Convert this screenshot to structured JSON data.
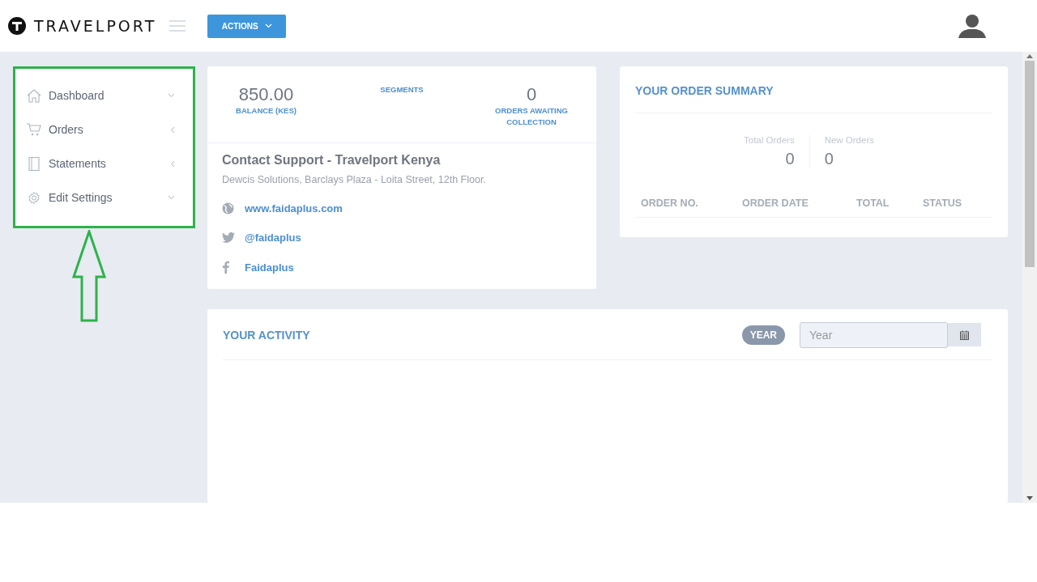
{
  "header": {
    "brand": "TRAVELPORT",
    "actions_button": {
      "label": "ACTIONS"
    }
  },
  "sidebar": {
    "highlighted": true,
    "items": [
      {
        "label": "Dashboard",
        "kind": "home",
        "expanded": true
      },
      {
        "label": "Orders",
        "kind": "cart",
        "expanded": false
      },
      {
        "label": "Statements",
        "kind": "book",
        "expanded": false
      },
      {
        "label": "Edit Settings",
        "kind": "gear",
        "expanded": true
      }
    ]
  },
  "account_card": {
    "stats": [
      {
        "value": "850.00",
        "label": "BALANCE (KES)"
      },
      {
        "label": "SEGMENTS"
      },
      {
        "value": "0",
        "label": "ORDERS AWAITING COLLECTION"
      }
    ],
    "support": {
      "title": "Contact Support - Travelport Kenya",
      "address": "Dewcis Solutions, Barclays Plaza - Loita Street, 12th Floor.",
      "links": [
        {
          "kind": "web",
          "text": "www.faidaplus.com"
        },
        {
          "kind": "twitter",
          "text": "@faidaplus"
        },
        {
          "kind": "facebook",
          "text": "Faidaplus"
        }
      ]
    }
  },
  "order_summary": {
    "title": "YOUR ORDER SUMMARY",
    "counters": [
      {
        "label": "Total Orders",
        "value": "0"
      },
      {
        "label": "New Orders",
        "value": "0"
      }
    ],
    "columns": [
      "ORDER NO.",
      "ORDER DATE",
      "TOTAL",
      "STATUS"
    ]
  },
  "activity": {
    "title": "YOUR ACTIVITY",
    "badge": "YEAR",
    "year_field": {
      "placeholder": "Year"
    }
  }
}
